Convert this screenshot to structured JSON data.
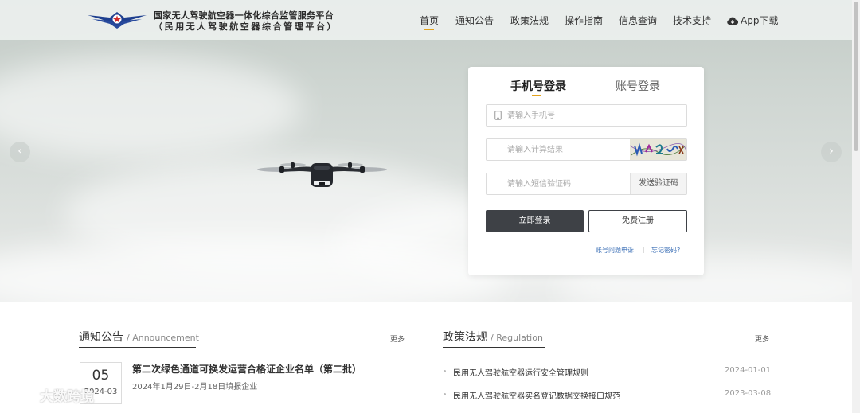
{
  "header": {
    "brand_line1": "国家无人驾驶航空器一体化综合监管服务平台",
    "brand_line2": "（民用无人驾驶航空器综合管理平台）",
    "nav": [
      "首页",
      "通知公告",
      "政策法规",
      "操作指南",
      "信息查询",
      "技术支持"
    ],
    "active_nav": "首页",
    "app_download": "App下载"
  },
  "carousel": {
    "prev_icon": "‹",
    "next_icon": "›"
  },
  "login": {
    "tabs": [
      "手机号登录",
      "账号登录"
    ],
    "active_tab": "手机号登录",
    "phone_placeholder": "请输入手机号",
    "captcha_placeholder": "请输入计算结果",
    "sms_placeholder": "请输入短信验证码",
    "send_code": "发送验证码",
    "login_button": "立即登录",
    "register_button": "免费注册",
    "account_issue": "账号问题申诉",
    "forgot_password": "忘记密码?"
  },
  "announcements": {
    "title": "通知公告",
    "subtitle": "/ Announcement",
    "more": "更多",
    "item": {
      "day": "05",
      "year_month": "2024-03",
      "title": "第二次绿色通道可换发运营合格证企业名单（第二批）",
      "desc": "2024年1月29日-2月18日填报企业"
    }
  },
  "regulations": {
    "title": "政策法规",
    "subtitle": "/ Regulation",
    "more": "更多",
    "items": [
      {
        "title": "民用无人驾驶航空器运行安全管理规则",
        "date": "2024-01-01"
      },
      {
        "title": "民用无人驾驶航空器实名登记数据交换接口规范",
        "date": "2023-03-08"
      }
    ]
  },
  "watermark": "大数跨境",
  "colors": {
    "accent": "#e3a11a",
    "login_button": "#3e4146",
    "link": "#3b6fb6"
  }
}
